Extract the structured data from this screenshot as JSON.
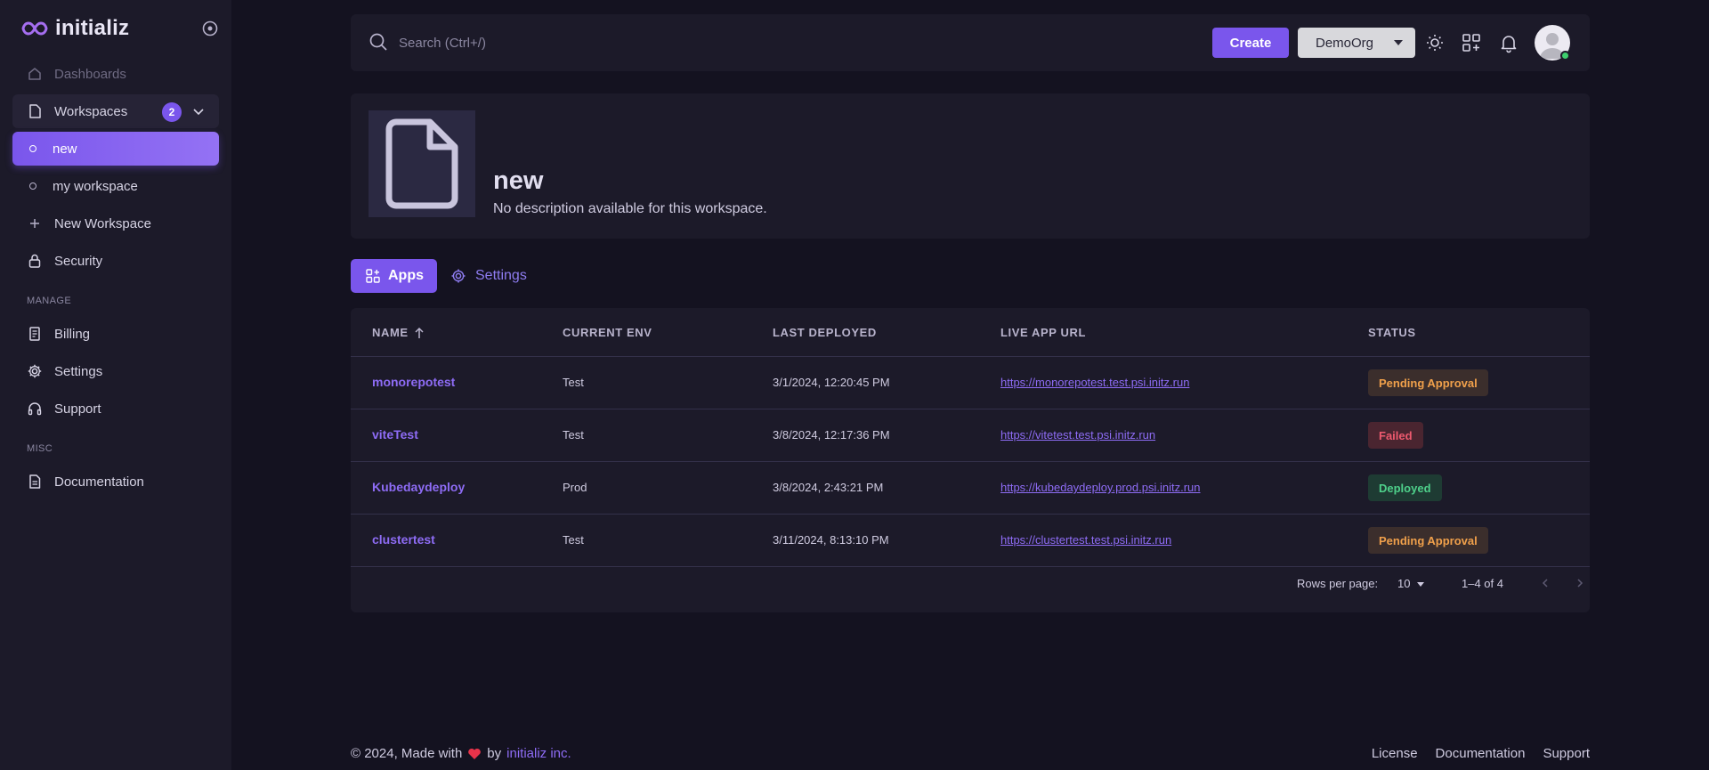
{
  "brand": {
    "name": "initializ",
    "logo_icon": "infinity-icon"
  },
  "sidebar": {
    "items": [
      {
        "label": "Dashboards",
        "icon": "home-icon"
      },
      {
        "label": "Workspaces",
        "icon": "file-icon",
        "badge": "2"
      },
      {
        "label": "new"
      },
      {
        "label": "my workspace"
      },
      {
        "label": "New Workspace",
        "icon": "plus-icon"
      },
      {
        "label": "Security",
        "icon": "lock-icon"
      }
    ],
    "manage_label": "MANAGE",
    "manage_items": [
      {
        "label": "Billing",
        "icon": "receipt-icon"
      },
      {
        "label": "Settings",
        "icon": "gear-icon"
      },
      {
        "label": "Support",
        "icon": "headphones-icon"
      }
    ],
    "misc_label": "MISC",
    "misc_items": [
      {
        "label": "Documentation",
        "icon": "document-icon"
      }
    ]
  },
  "topbar": {
    "search_placeholder": "Search (Ctrl+/)",
    "create_label": "Create",
    "org_selected": "DemoOrg"
  },
  "workspace": {
    "title": "new",
    "description": "No description available for this workspace."
  },
  "tabs": {
    "apps": "Apps",
    "settings": "Settings"
  },
  "table": {
    "headers": {
      "name": "NAME",
      "env": "CURRENT ENV",
      "deployed": "LAST DEPLOYED",
      "url": "LIVE APP URL",
      "status": "STATUS"
    },
    "rows": [
      {
        "name": "monorepotest",
        "env": "Test",
        "deployed": "3/1/2024, 12:20:45 PM",
        "url": "https://monorepotest.test.psi.initz.run",
        "status": "Pending Approval"
      },
      {
        "name": "viteTest",
        "env": "Test",
        "deployed": "3/8/2024, 12:17:36 PM",
        "url": "https://vitetest.test.psi.initz.run",
        "status": "Failed"
      },
      {
        "name": "Kubedaydeploy",
        "env": "Prod",
        "deployed": "3/8/2024, 2:43:21 PM",
        "url": "https://kubedaydeploy.prod.psi.initz.run",
        "status": "Deployed"
      },
      {
        "name": "clustertest",
        "env": "Test",
        "deployed": "3/11/2024, 8:13:10 PM",
        "url": "https://clustertest.test.psi.initz.run",
        "status": "Pending Approval"
      }
    ],
    "pagination": {
      "rows_label": "Rows per page:",
      "rows_value": "10",
      "range": "1–4 of 4"
    }
  },
  "footer": {
    "prefix": "© 2024, Made with",
    "by": "by",
    "company": "initializ inc.",
    "links": [
      "License",
      "Documentation",
      "Support"
    ]
  },
  "colors": {
    "accent": "#7a56ec",
    "background": "#141220",
    "surface": "#1c1a29",
    "pending": "#f0a04b",
    "failed": "#ee5a6f",
    "deployed": "#4ed08a"
  }
}
